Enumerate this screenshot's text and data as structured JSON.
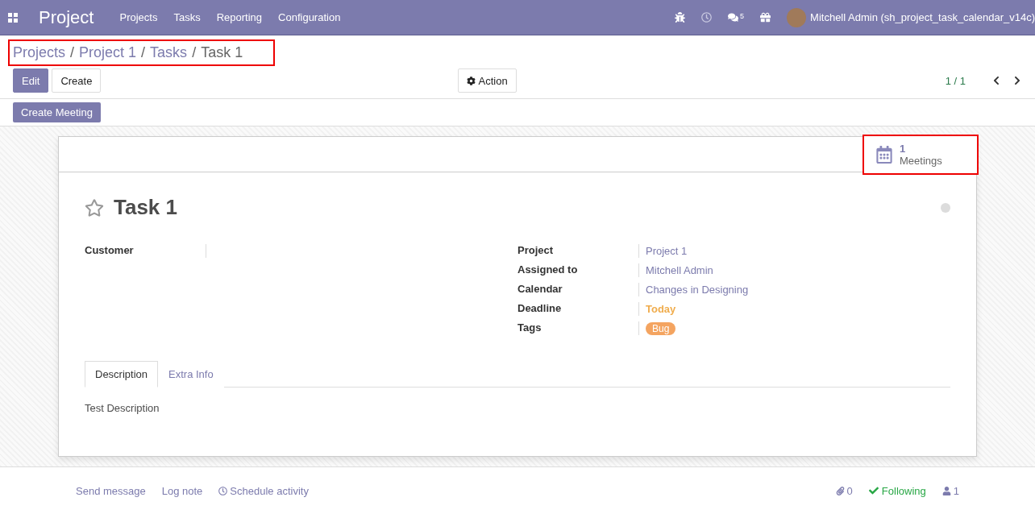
{
  "navbar": {
    "app_title": "Project",
    "menu": [
      "Projects",
      "Tasks",
      "Reporting",
      "Configuration"
    ],
    "chat_count": "5",
    "user": "Mitchell Admin (sh_project_task_calendar_v14c)"
  },
  "breadcrumbs": {
    "separator": "/",
    "items": [
      "Projects",
      "Project 1",
      "Tasks",
      "Task 1"
    ]
  },
  "control_panel": {
    "edit": "Edit",
    "create": "Create",
    "action": "Action",
    "pager": "1 / 1"
  },
  "header_button": "Create Meeting",
  "smart_button": {
    "count": "1",
    "label": "Meetings"
  },
  "task": {
    "title": "Task 1",
    "starred": false
  },
  "left_fields": [
    {
      "label": "Customer"
    }
  ],
  "right_fields": [
    {
      "label": "Project",
      "value": "Project 1",
      "kind": "link"
    },
    {
      "label": "Assigned to",
      "value": "Mitchell Admin",
      "kind": "link"
    },
    {
      "label": "Calendar",
      "value": "Changes in Designing",
      "kind": "link"
    },
    {
      "label": "Deadline",
      "value": "Today",
      "kind": "date"
    },
    {
      "label": "Tags",
      "value": "Bug",
      "kind": "tag",
      "color": "#f4a460"
    }
  ],
  "tabs": [
    {
      "label": "Description",
      "selected": true
    },
    {
      "label": "Extra Info",
      "selected": false
    }
  ],
  "tab_content": "Test Description",
  "chatter": {
    "send": "Send message",
    "log": "Log note",
    "schedule": "Schedule activity",
    "attachments": "0",
    "following": "Following",
    "followers": "1"
  }
}
